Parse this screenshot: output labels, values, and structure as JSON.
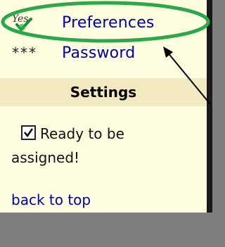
{
  "sidebar": {
    "items": [
      {
        "label": "Preferences",
        "icon": "yes-check-icon"
      },
      {
        "label": "Password",
        "icon": "asterisks-icon"
      }
    ],
    "password_icon_text": "***"
  },
  "settings": {
    "header": "Settings",
    "ready_checkbox": {
      "checked": true,
      "label_line1": "Ready to be",
      "label_line2": "assigned!"
    }
  },
  "footer": {
    "back_to_top": "back to top"
  },
  "colors": {
    "panel_bg": "#fffde0",
    "link": "#0000a8",
    "header_bg": "#f3e9c1",
    "highlight": "#2aa84a",
    "bottom_bg": "#7f7f7f"
  }
}
